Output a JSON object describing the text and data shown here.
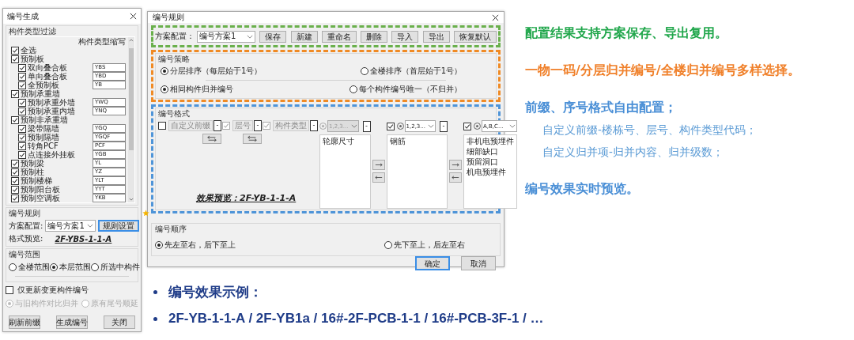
{
  "left_panel": {
    "title": "编号生成",
    "filter": {
      "title": "构件类型过滤",
      "code_header": "构件类型缩写",
      "tree": [
        {
          "label": "全选",
          "checked": true
        },
        {
          "label": "预制板",
          "checked": true,
          "children": [
            {
              "label": "双向叠合板",
              "checked": true,
              "code": "YBS"
            },
            {
              "label": "单向叠合板",
              "checked": true,
              "code": "YBD"
            },
            {
              "label": "全预制板",
              "checked": true,
              "code": "YB"
            }
          ]
        },
        {
          "label": "预制承重墙",
          "checked": true,
          "children": [
            {
              "label": "预制承重外墙",
              "checked": true,
              "code": "YWQ"
            },
            {
              "label": "预制承重内墙",
              "checked": true,
              "code": "YNQ"
            }
          ]
        },
        {
          "label": "预制非承重墙",
          "checked": true,
          "children": [
            {
              "label": "梁带隔墙",
              "checked": true,
              "code": "YGQ"
            },
            {
              "label": "预制隔墙",
              "checked": true,
              "code": "YGQF"
            },
            {
              "label": "转角PCF",
              "checked": true,
              "code": "PCF"
            },
            {
              "label": "点连接外挂板",
              "checked": true,
              "code": "YGB"
            }
          ]
        },
        {
          "label": "预制梁",
          "checked": true,
          "code": "YL"
        },
        {
          "label": "预制柱",
          "checked": true,
          "code": "YZ"
        },
        {
          "label": "预制楼梯",
          "checked": true,
          "code": "YLT"
        },
        {
          "label": "预制阳台板",
          "checked": true,
          "code": "YYT"
        },
        {
          "label": "预制空调板",
          "checked": true,
          "code": "YKB"
        }
      ]
    },
    "rule": {
      "title": "编号规则",
      "scheme_label": "方案配置:",
      "scheme": "编号方案1",
      "button": "规则设置",
      "preview_label": "格式预览:",
      "preview": "2F-YBS-1-1-A"
    },
    "range": {
      "title": "编号范围",
      "options": [
        {
          "label": "全楼范围",
          "selected": false
        },
        {
          "label": "本层范围",
          "selected": true
        },
        {
          "label": "所选中构件",
          "selected": false
        }
      ]
    },
    "only_changed": {
      "label": "仅更新变更构件编号",
      "checked": false,
      "options": [
        {
          "label": "与旧构件对比归并",
          "selected": true,
          "disabled": true
        },
        {
          "label": "原有尾号顺延",
          "selected": false,
          "disabled": true
        }
      ]
    },
    "buttons": [
      "刷新前缀",
      "生成编号",
      "关闭"
    ]
  },
  "dialog": {
    "title": "编号规则",
    "toolbar": {
      "label": "方案配置：",
      "scheme": "编号方案1",
      "buttons": [
        "保存",
        "新建",
        "重命名",
        "删除",
        "导入",
        "导出",
        "恢复默认"
      ]
    },
    "strategy": {
      "title": "编号策略",
      "sort": [
        {
          "label": "分层排序（每层始于1号）",
          "selected": true
        },
        {
          "label": "全楼排序（首层始于1号）",
          "selected": false
        }
      ],
      "merge": [
        {
          "label": "相同构件归并编号",
          "selected": true
        },
        {
          "label": "每个构件编号唯一（不归并）",
          "selected": false
        }
      ]
    },
    "format": {
      "title": "编号格式",
      "prefix": [
        {
          "field": "自定义前缀",
          "checked": false,
          "disabled": false,
          "sep": "-"
        },
        {
          "field": "层号",
          "checked": true,
          "disabled": true,
          "sep": "-"
        },
        {
          "field": "构件类型",
          "checked": true,
          "disabled": true,
          "sep": "-"
        }
      ],
      "merge": [
        {
          "kind": "fixed",
          "select": "1,2,3...",
          "disabled": true,
          "items": [
            "轮廓尺寸"
          ],
          "sep": "-"
        },
        {
          "kind": "optional",
          "checked": true,
          "select": "1,2,3...",
          "disabled": false,
          "items": [
            "钢筋"
          ],
          "sep": "-"
        },
        {
          "kind": "optional",
          "checked": true,
          "select": "A,B,C...",
          "disabled": false,
          "items": [
            "非机电预埋件",
            "细部缺口",
            "预留洞口",
            "机电预埋件"
          ]
        }
      ],
      "preview": "效果预览：2F-YB-1-1-A"
    },
    "order": {
      "title": "编号顺序",
      "options": [
        {
          "label": "先左至右，后下至上",
          "selected": true
        },
        {
          "label": "先下至上，后左至右",
          "selected": false
        }
      ]
    },
    "buttons": [
      {
        "label": "确定",
        "default": true
      },
      {
        "label": "取消",
        "default": false
      }
    ]
  },
  "notes": [
    {
      "kind": "heading",
      "text": "配置结果支持方案保存、导出复用。",
      "color": "#1fa64a"
    },
    {
      "kind": "heading",
      "text": "一物一码/分层归并编号/全楼归并编号多样选择。",
      "color": "#f0802a"
    },
    {
      "kind": "heading",
      "text": "前缀、序号格式自由配置；",
      "color": "#4a8fd6"
    },
    {
      "kind": "sub",
      "text": "自定义前缀-楼栋号、层号、构件类型代码；",
      "color": "#5b9bd5"
    },
    {
      "kind": "sub",
      "text": "自定义归并项-归并内容、归并级数；",
      "color": "#5b9bd5"
    },
    {
      "kind": "heading",
      "text": "编号效果实时预览。",
      "color": "#4a8fd6"
    }
  ],
  "examples": [
    "编号效果示例：",
    "2F-YB-1-1-A / 2F-YB1a / 16#-2F-PCB-1-1 / 16#-PCB-3F-1 / …"
  ]
}
